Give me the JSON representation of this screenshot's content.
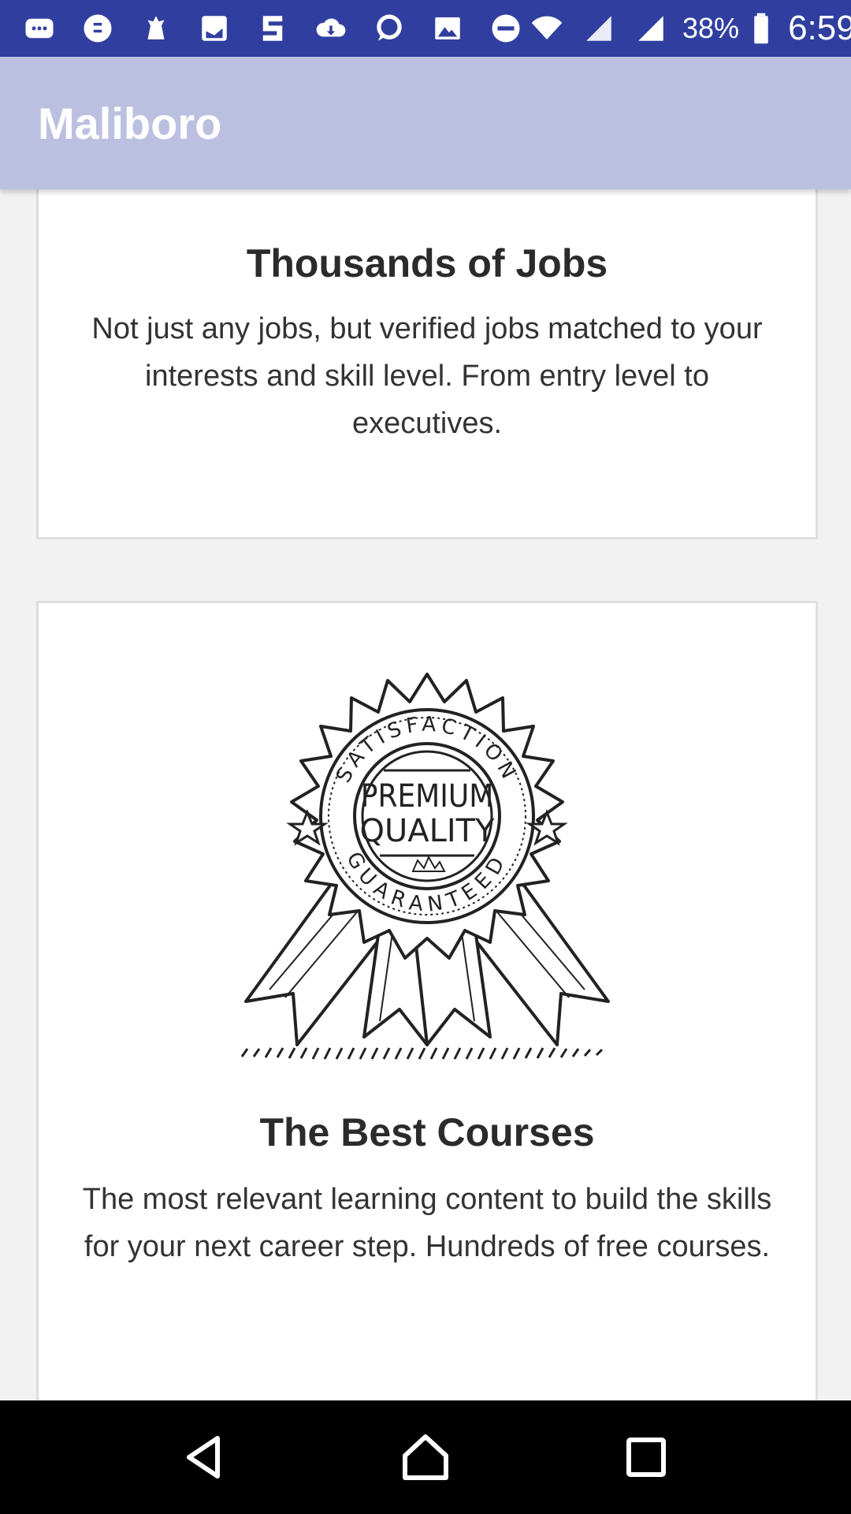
{
  "status_bar": {
    "battery": "38%",
    "time": "6:59",
    "icons_left": [
      "chat-icon",
      "messenger-icon",
      "premier-league-icon",
      "outlook-icon",
      "stripe-icon",
      "download-icon",
      "whatsapp-icon",
      "gallery-icon",
      "dnd-icon"
    ],
    "icons_right": [
      "wifi-icon",
      "signal-no-data-icon",
      "signal-icon",
      "battery-icon"
    ]
  },
  "app_bar": {
    "title": "Maliboro"
  },
  "cards": [
    {
      "title": "Thousands of Jobs",
      "body": "Not just any jobs, but verified jobs matched to your interests and skill level. From entry level to executives."
    },
    {
      "image": "premium-quality-badge",
      "badge": {
        "top_arc": "SATISFACTION",
        "line1": "PREMIUM",
        "line2": "QUALITY",
        "bottom_arc": "GUARANTEED"
      },
      "title": "The Best Courses",
      "body": "The most relevant learning content to build the skills for your next career step. Hundreds of free courses."
    }
  ],
  "nav_bar": {
    "buttons": [
      "back-icon",
      "home-icon",
      "recents-icon"
    ]
  },
  "colors": {
    "status_bar": "#303f9f",
    "app_bar": "#bcc0e0",
    "background": "#f2f2f2"
  }
}
